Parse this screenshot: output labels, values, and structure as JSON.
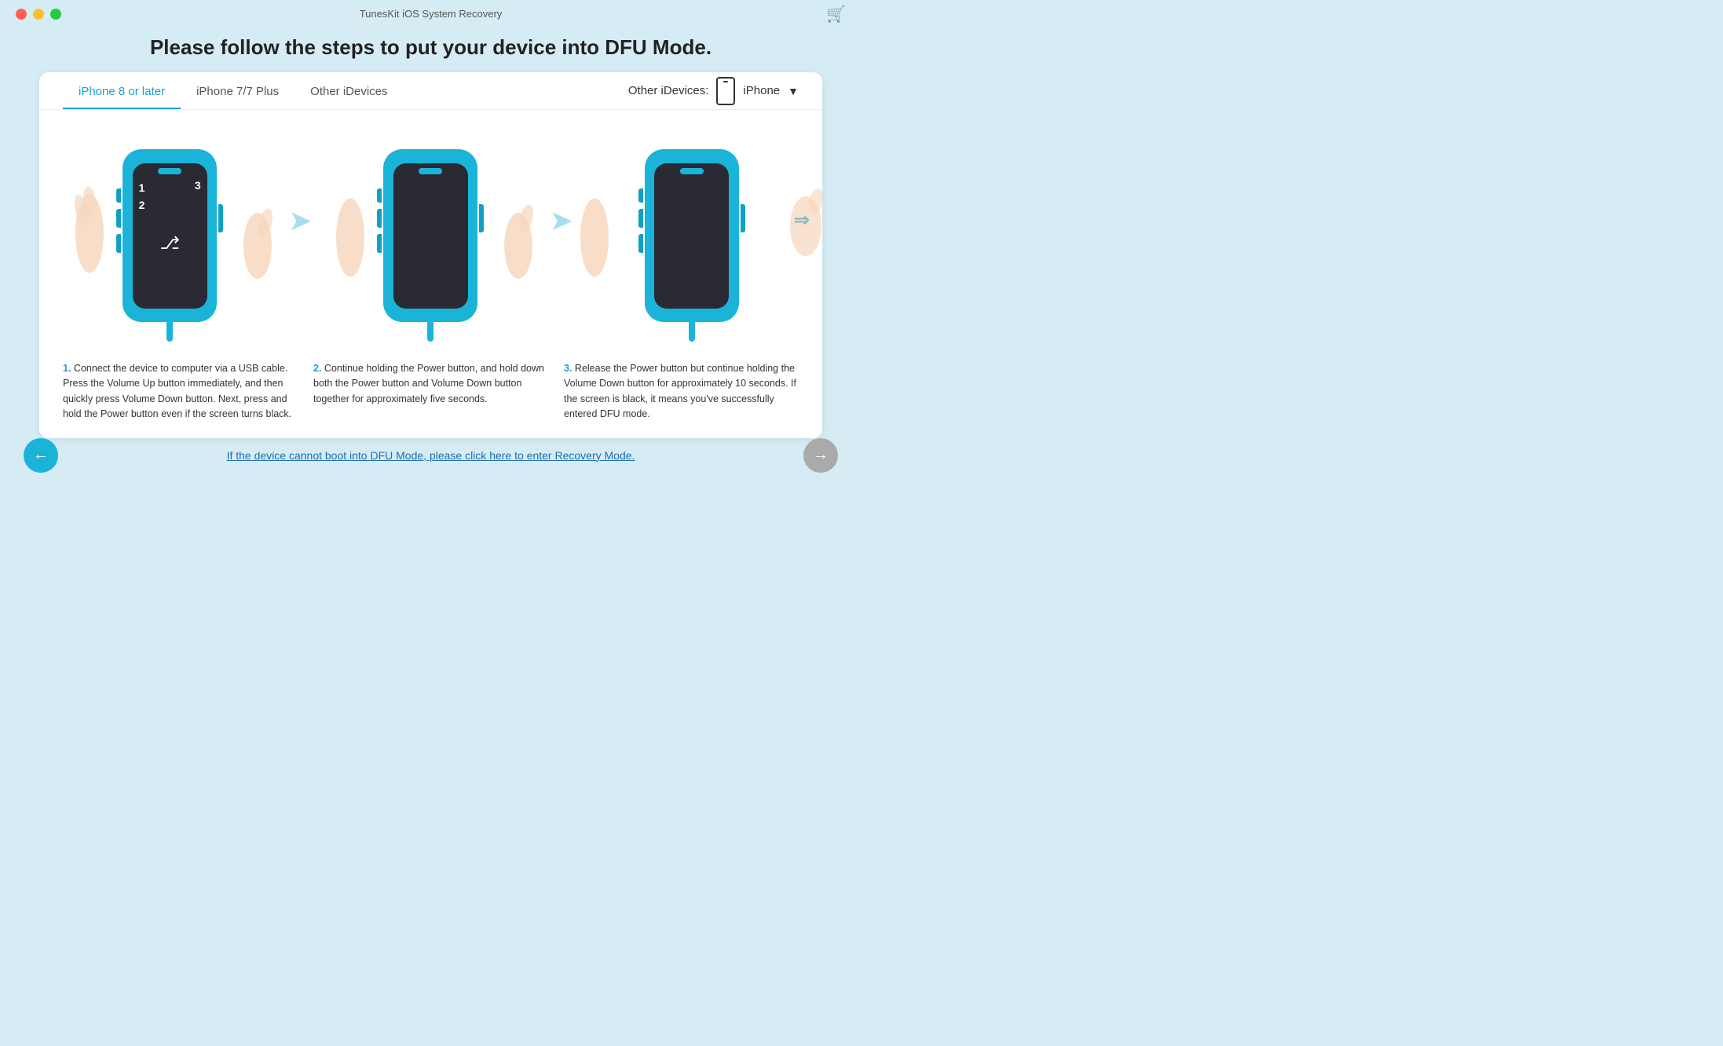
{
  "titleBar": {
    "appTitle": "TunesKit iOS System Recovery",
    "cartIcon": "🛒"
  },
  "mainTitle": "Please follow the steps to put your device into DFU Mode.",
  "tabs": [
    {
      "id": "tab-iphone8",
      "label": "iPhone 8 or later",
      "active": true
    },
    {
      "id": "tab-iphone7",
      "label": "iPhone 7/7 Plus",
      "active": false
    },
    {
      "id": "tab-other",
      "label": "Other iDevices",
      "active": false
    }
  ],
  "otherDevices": {
    "label": "Other iDevices:",
    "deviceLabel": "iPhone"
  },
  "steps": [
    {
      "number": "1",
      "description": "Connect the device to computer via a USB cable. Press the Volume Up button immediately, and then quickly press Volume Down button. Next, press and hold the Power button even if the screen turns black."
    },
    {
      "number": "2",
      "description": "Continue holding the Power button, and hold down both the Power button and Volume Down button together for approximately five seconds."
    },
    {
      "number": "3",
      "description": "Release the Power button but continue holding the Volume Down button for approximately 10 seconds. If the screen is black, it means you've successfully entered DFU mode."
    }
  ],
  "footer": {
    "recoveryLink": "If the device cannot boot into DFU Mode, please click here to enter Recovery Mode.",
    "backLabel": "←",
    "nextLabel": "→"
  }
}
